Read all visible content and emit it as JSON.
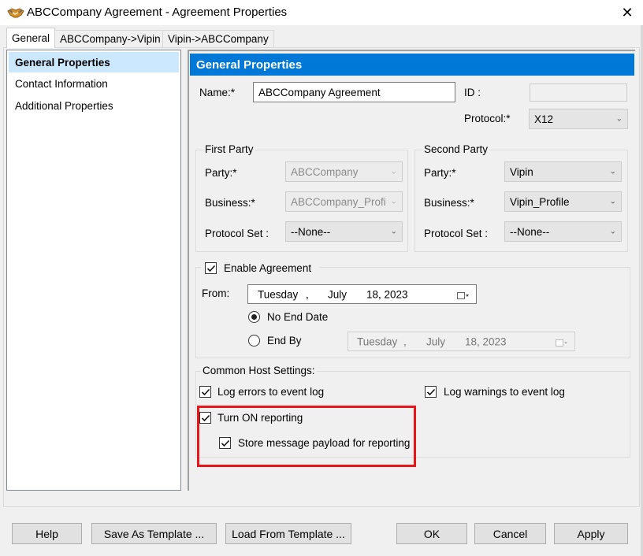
{
  "window": {
    "title": "ABCCompany Agreement - Agreement Properties",
    "close_glyph": "✕",
    "icon": "handshake-icon"
  },
  "tabs": [
    {
      "label": "General",
      "active": true
    },
    {
      "label": "ABCCompany->Vipin",
      "active": false
    },
    {
      "label": "Vipin->ABCCompany",
      "active": false
    }
  ],
  "nav": {
    "items": [
      {
        "label": "General Properties",
        "selected": true
      },
      {
        "label": "Contact Information",
        "selected": false
      },
      {
        "label": "Additional Properties",
        "selected": false
      }
    ]
  },
  "panel": {
    "header": "General Properties",
    "name_label": "Name:*",
    "name_value": "ABCCompany Agreement",
    "id_label": "ID :",
    "id_value": "",
    "protocol_label": "Protocol:*",
    "protocol_value": "X12"
  },
  "first_party": {
    "title": "First Party",
    "party_label": "Party:*",
    "party_value": "ABCCompany",
    "business_label": "Business:*",
    "business_value": "ABCCompany_Profi",
    "protocol_set_label": "Protocol Set :",
    "protocol_set_value": "--None--"
  },
  "second_party": {
    "title": "Second Party",
    "party_label": "Party:*",
    "party_value": "Vipin",
    "business_label": "Business:*",
    "business_value": "Vipin_Profile",
    "protocol_set_label": "Protocol Set :",
    "protocol_set_value": "--None--"
  },
  "agreement": {
    "enable_label": "Enable Agreement",
    "enable_checked": true,
    "from_label": "From:",
    "from_date": {
      "weekday": "Tuesday",
      "sep": ",",
      "month": "July",
      "day_year": "18, 2023"
    },
    "no_end_label": "No End Date",
    "no_end_selected": true,
    "end_by_label": "End By",
    "end_by_selected": false,
    "end_by_date": {
      "weekday": "Tuesday",
      "sep": ",",
      "month": "July",
      "day_year": "18, 2023"
    }
  },
  "host_settings": {
    "title": "Common Host Settings:",
    "log_errors_label": "Log errors to event log",
    "log_errors_checked": true,
    "log_warnings_label": "Log warnings to event log",
    "log_warnings_checked": true,
    "turn_on_reporting_label": "Turn ON reporting",
    "turn_on_reporting_checked": true,
    "store_payload_label": "Store message payload for reporting",
    "store_payload_checked": true,
    "highlight_color": "#e8151b"
  },
  "buttons": {
    "help": "Help",
    "save_template": "Save As Template ...",
    "load_template": "Load From Template ...",
    "ok": "OK",
    "cancel": "Cancel",
    "apply": "Apply"
  },
  "colors": {
    "header_blue": "#0078d7",
    "selection": "#cce8ff"
  }
}
